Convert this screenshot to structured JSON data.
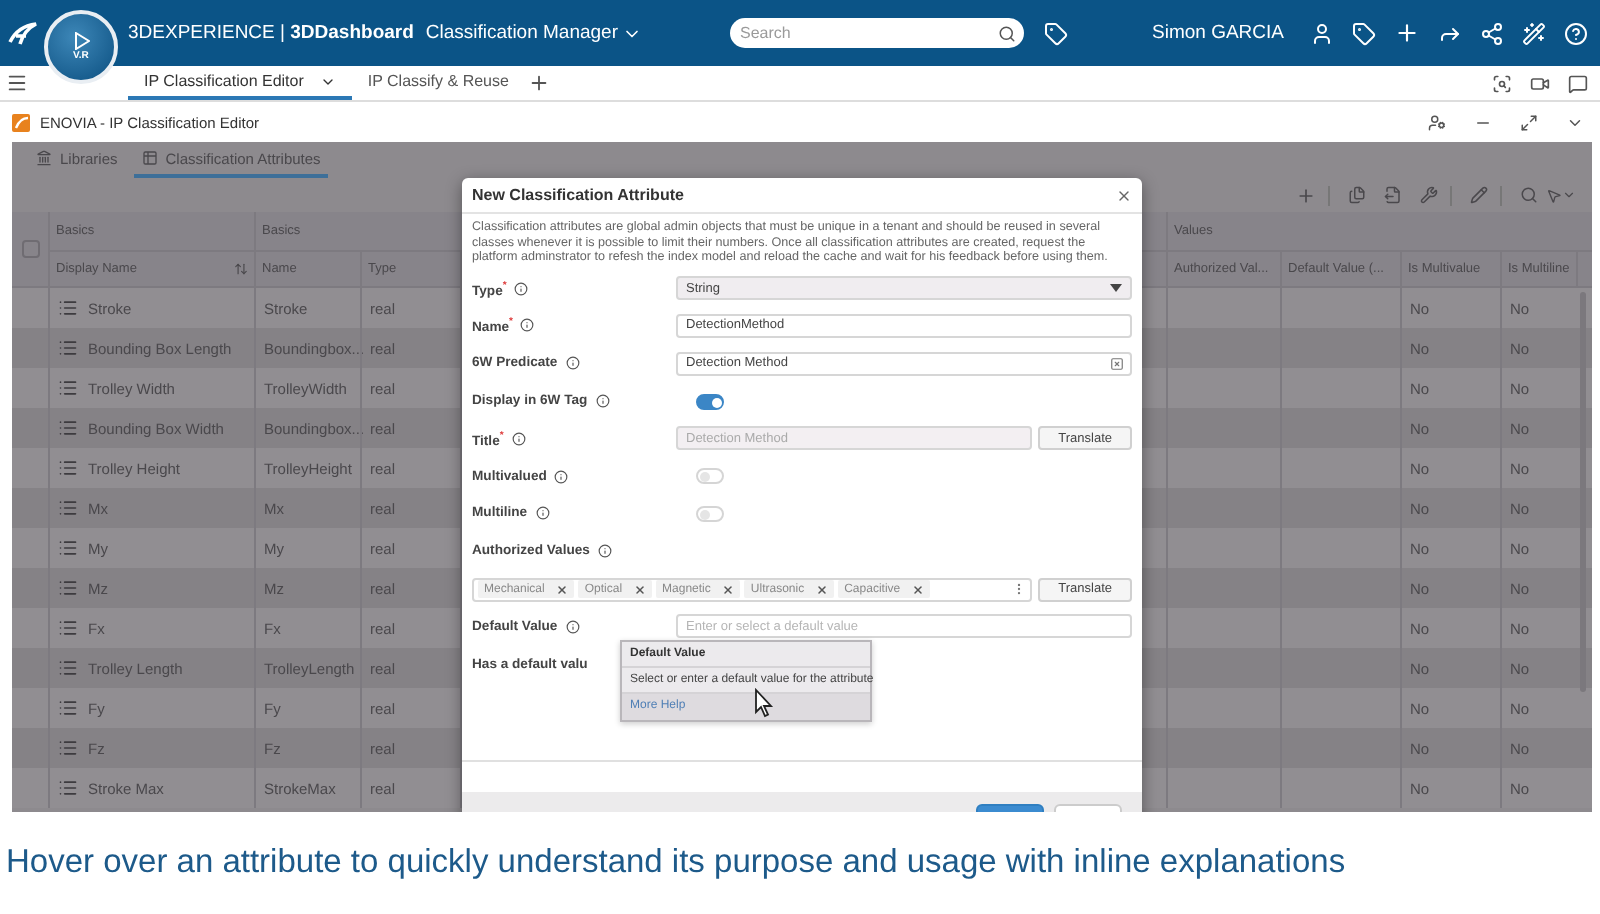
{
  "top_bar": {
    "compass_label": "V.R",
    "brand": "3DEXPERIENCE | **3DDashboard**",
    "app_name": "Classification Manager",
    "search": {
      "placeholder": "Search"
    },
    "user": "Simon GARCIA"
  },
  "tabs": [
    {
      "label": "IP Classification Editor",
      "selected": true
    },
    {
      "label": "IP Classify & Reuse",
      "selected": false
    }
  ],
  "app_header": {
    "title": "ENOVIA - IP Classification Editor"
  },
  "view_tabs": [
    {
      "label": "Libraries",
      "selected": false
    },
    {
      "label": "Classification Attributes",
      "selected": true
    }
  ],
  "table": {
    "select_all": {
      "checked": false
    },
    "groups": [
      "Basics",
      "Basics",
      "Values"
    ],
    "columns": [
      "Display Name",
      "Name",
      "Type",
      "Authorized Val...",
      "Default Value (...",
      "Is Multivalue",
      "Is Multiline"
    ],
    "rows": [
      {
        "display_name": "Stroke",
        "name": "Stroke",
        "type": "real",
        "is_multivalue": "No",
        "is_multiline": "No"
      },
      {
        "display_name": "Bounding Box Length",
        "name": "Boundingbox...",
        "type": "real",
        "is_multivalue": "No",
        "is_multiline": "No"
      },
      {
        "display_name": "Trolley Width",
        "name": "TrolleyWidth",
        "type": "real",
        "is_multivalue": "No",
        "is_multiline": "No"
      },
      {
        "display_name": "Bounding Box Width",
        "name": "Boundingbox...",
        "type": "real",
        "is_multivalue": "No",
        "is_multiline": "No"
      },
      {
        "display_name": "Trolley Height",
        "name": "TrolleyHeight",
        "type": "real",
        "is_multivalue": "No",
        "is_multiline": "No"
      },
      {
        "display_name": "Mx",
        "name": "Mx",
        "type": "real",
        "is_multivalue": "No",
        "is_multiline": "No"
      },
      {
        "display_name": "My",
        "name": "My",
        "type": "real",
        "is_multivalue": "No",
        "is_multiline": "No"
      },
      {
        "display_name": "Mz",
        "name": "Mz",
        "type": "real",
        "is_multivalue": "No",
        "is_multiline": "No"
      },
      {
        "display_name": "Fx",
        "name": "Fx",
        "type": "real",
        "is_multivalue": "No",
        "is_multiline": "No"
      },
      {
        "display_name": "Trolley Length",
        "name": "TrolleyLength",
        "type": "real",
        "is_multivalue": "No",
        "is_multiline": "No"
      },
      {
        "display_name": "Fy",
        "name": "Fy",
        "type": "real",
        "is_multivalue": "No",
        "is_multiline": "No"
      },
      {
        "display_name": "Fz",
        "name": "Fz",
        "type": "real",
        "is_multivalue": "No",
        "is_multiline": "No"
      },
      {
        "display_name": "Stroke Max",
        "name": "StrokeMax",
        "type": "real",
        "is_multivalue": "No",
        "is_multiline": "No"
      }
    ]
  },
  "dialog": {
    "title": "New Classification Attribute",
    "description": "Classification attributes are global admin objects that must be unique in a tenant and should be reused in several classes whenever it is possible to limit their numbers. Once all classification attributes are created, request the platform adminstrator to refesh the index model and reload the cache and wait for his feedback before using them.",
    "fields": [
      {
        "kind": "select",
        "label": "Type$^{*}$",
        "value": "String"
      },
      {
        "kind": "text",
        "label": "Name$^{*}$",
        "value": "DetectionMethod"
      },
      {
        "kind": "clearable",
        "label": "6W Predicate",
        "value": "Detection Method"
      },
      {
        "kind": "toggle",
        "label": "Display in 6W Tag",
        "on": true
      },
      {
        "kind": "translate",
        "label": "Title$^{*}$",
        "value": "Detection Method",
        "disabled": true,
        "button": "Translate"
      },
      {
        "kind": "toggle",
        "label": "Multivalued",
        "on": false
      },
      {
        "kind": "toggle",
        "label": "Multiline",
        "on": false
      },
      {
        "kind": "chips",
        "label": "Authorized Values",
        "chips": [
          "Mechanical",
          "Optical",
          "Magnetic",
          "Ultrasonic",
          "Capacitive"
        ],
        "button": "Translate"
      },
      {
        "kind": "text",
        "label": "Default Value",
        "placeholder": "Enter or select a default value"
      },
      {
        "kind": "note",
        "label": "Has a default valu"
      }
    ],
    "tooltip": {
      "title": "Default Value",
      "text": "Select or enter a default value for the attribute",
      "link": "More Help"
    }
  },
  "caption": "Hover over an attribute to quickly understand its purpose and usage with inline explanations"
}
